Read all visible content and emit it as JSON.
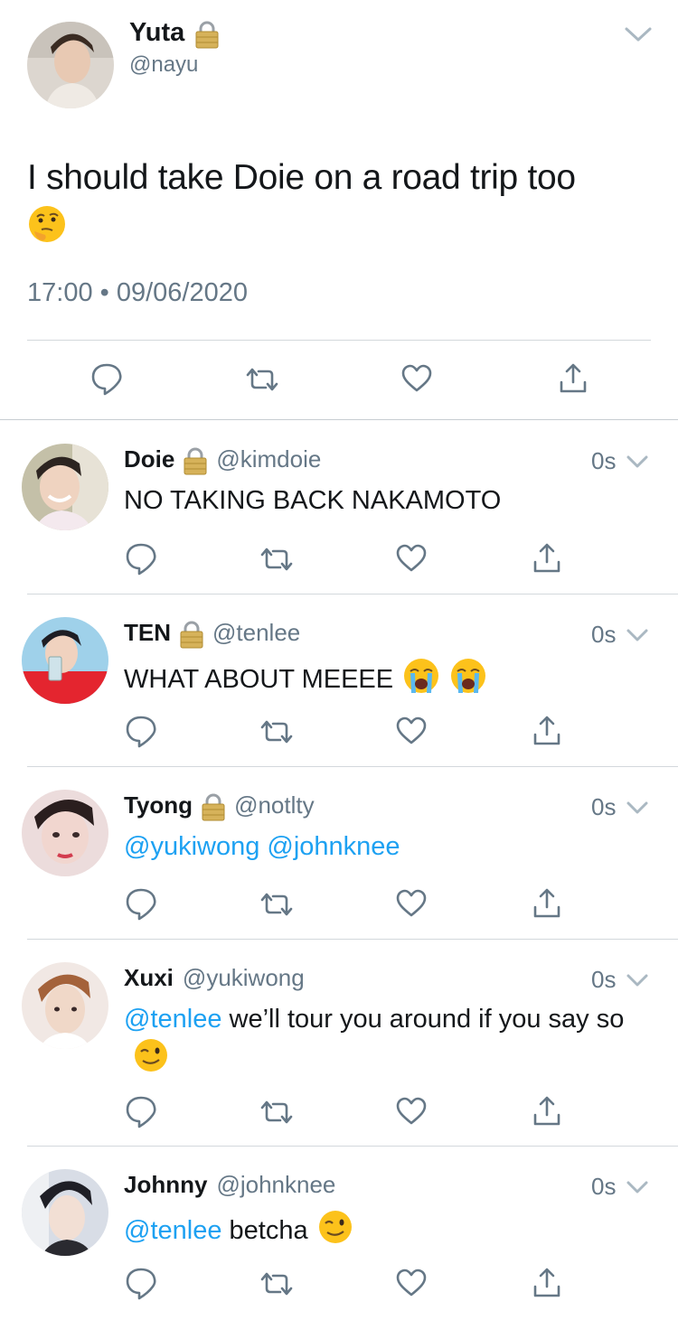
{
  "main_tweet": {
    "name": "Yuta",
    "handle": "@nayu",
    "text": "I should take Doie on a road trip too",
    "emoji": "thinking-face",
    "timestamp": "17:00 • 09/06/2020"
  },
  "replies": [
    {
      "name": "Doie",
      "locked": true,
      "handle": "@kimdoie",
      "time": "0s",
      "text_parts": [
        {
          "t": "NO TAKING BACK NAKAMOTO",
          "mention": false
        }
      ],
      "emojis": []
    },
    {
      "name": "TEN",
      "locked": true,
      "handle": "@tenlee",
      "time": "0s",
      "text_parts": [
        {
          "t": "WHAT ABOUT MEEEE",
          "mention": false
        }
      ],
      "emojis": [
        "loudly-crying-face",
        "loudly-crying-face"
      ]
    },
    {
      "name": "Tyong",
      "locked": true,
      "handle": "@notlty",
      "time": "0s",
      "text_parts": [
        {
          "t": "@yukiwong",
          "mention": true
        },
        {
          "t": " ",
          "mention": false
        },
        {
          "t": "@johnknee",
          "mention": true
        }
      ],
      "emojis": []
    },
    {
      "name": "Xuxi",
      "locked": false,
      "handle": "@yukiwong",
      "time": "0s",
      "text_parts": [
        {
          "t": "@tenlee",
          "mention": true
        },
        {
          "t": " we’ll tour you around if you say so",
          "mention": false
        }
      ],
      "emojis": [
        "winking-face"
      ]
    },
    {
      "name": "Johnny",
      "locked": false,
      "handle": "@johnknee",
      "time": "0s",
      "text_parts": [
        {
          "t": "@tenlee",
          "mention": true
        },
        {
          "t": " betcha",
          "mention": false
        }
      ],
      "emojis": [
        "winking-face"
      ]
    }
  ],
  "icons": {
    "reply": "speech-bubble-icon",
    "retweet": "retweet-icon",
    "like": "heart-icon",
    "share": "share-icon",
    "lock": "padlock-icon",
    "menu": "chevron-down-icon"
  },
  "colors": {
    "text": "#14171a",
    "secondary": "#657786",
    "mention": "#1da1f2",
    "divider": "#d3d8dc"
  }
}
